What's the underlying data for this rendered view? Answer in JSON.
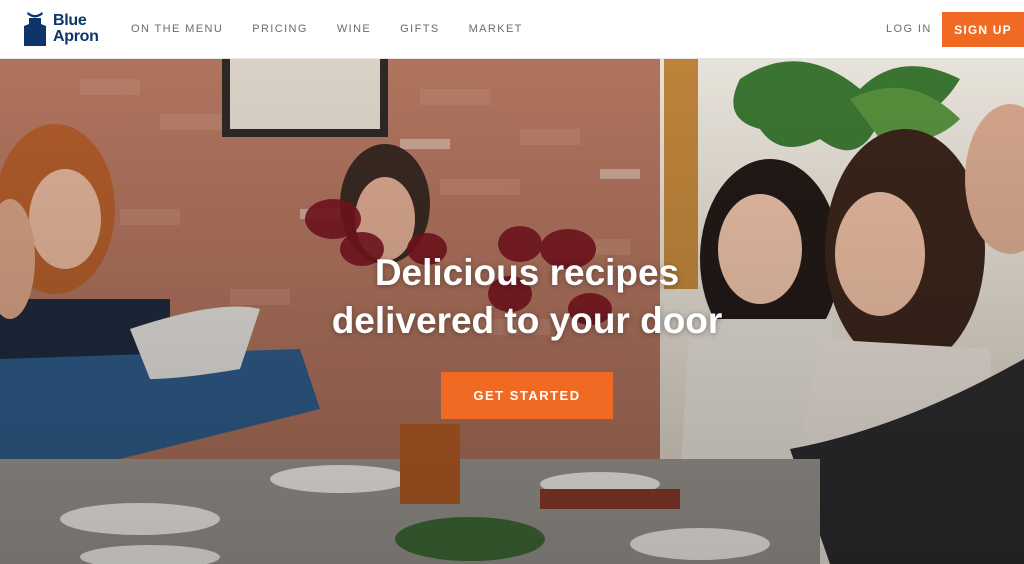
{
  "brand": {
    "name_line1": "Blue",
    "name_line2": "Apron",
    "color": "#0f346c",
    "accent": "#f06a24"
  },
  "nav": {
    "items": [
      "ON THE MENU",
      "PRICING",
      "WINE",
      "GIFTS",
      "MARKET"
    ],
    "login_label": "LOG IN",
    "signup_label": "SIGN UP"
  },
  "hero": {
    "headline_line1": "Delicious recipes",
    "headline_line2": "delivered to your door",
    "cta_label": "GET STARTED",
    "image_description_icon": "dinner-party-photo"
  }
}
